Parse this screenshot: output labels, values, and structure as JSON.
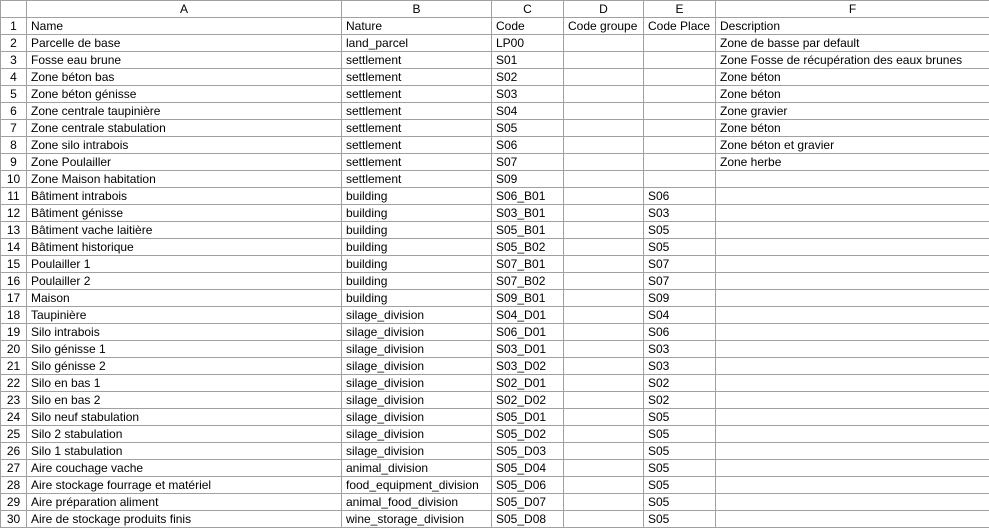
{
  "columns": [
    "A",
    "B",
    "C",
    "D",
    "E",
    "F"
  ],
  "header_row": [
    "Name",
    "Nature",
    "Code",
    "Code groupe",
    "Code Place",
    "Description"
  ],
  "chart_data": {
    "type": "table",
    "title": "",
    "columns": [
      "Name",
      "Nature",
      "Code",
      "Code groupe",
      "Code Place",
      "Description"
    ],
    "rows": [
      [
        "Parcelle de base",
        "land_parcel",
        "LP00",
        "",
        "",
        "Zone de basse par default"
      ],
      [
        "Fosse eau brune",
        "settlement",
        "S01",
        "",
        "",
        "Zone Fosse de récupération des eaux brunes"
      ],
      [
        "Zone béton bas",
        "settlement",
        "S02",
        "",
        "",
        "Zone béton"
      ],
      [
        "Zone béton génisse",
        "settlement",
        "S03",
        "",
        "",
        "Zone béton"
      ],
      [
        "Zone centrale taupinière",
        "settlement",
        "S04",
        "",
        "",
        "Zone gravier"
      ],
      [
        "Zone centrale stabulation",
        "settlement",
        "S05",
        "",
        "",
        "Zone béton"
      ],
      [
        "Zone silo intrabois",
        "settlement",
        "S06",
        "",
        "",
        "Zone béton et gravier"
      ],
      [
        "Zone Poulailler",
        "settlement",
        "S07",
        "",
        "",
        "Zone herbe"
      ],
      [
        "Zone Maison habitation",
        "settlement",
        "S09",
        "",
        "",
        ""
      ],
      [
        "Bâtiment intrabois",
        "building",
        "S06_B01",
        "",
        "S06",
        ""
      ],
      [
        "Bâtiment génisse",
        "building",
        "S03_B01",
        "",
        "S03",
        ""
      ],
      [
        "Bâtiment vache laitière",
        "building",
        "S05_B01",
        "",
        "S05",
        ""
      ],
      [
        "Bâtiment historique",
        "building",
        "S05_B02",
        "",
        "S05",
        ""
      ],
      [
        "Poulailler 1",
        "building",
        "S07_B01",
        "",
        "S07",
        ""
      ],
      [
        "Poulailler 2",
        "building",
        "S07_B02",
        "",
        "S07",
        ""
      ],
      [
        "Maison",
        "building",
        "S09_B01",
        "",
        "S09",
        ""
      ],
      [
        "Taupinière",
        "silage_division",
        "S04_D01",
        "",
        "S04",
        ""
      ],
      [
        "Silo intrabois",
        "silage_division",
        "S06_D01",
        "",
        "S06",
        ""
      ],
      [
        "Silo génisse 1",
        "silage_division",
        "S03_D01",
        "",
        "S03",
        ""
      ],
      [
        "Silo génisse 2",
        "silage_division",
        "S03_D02",
        "",
        "S03",
        ""
      ],
      [
        "Silo en bas 1",
        "silage_division",
        "S02_D01",
        "",
        "S02",
        ""
      ],
      [
        "Silo en bas 2",
        "silage_division",
        "S02_D02",
        "",
        "S02",
        ""
      ],
      [
        "Silo neuf stabulation",
        "silage_division",
        "S05_D01",
        "",
        "S05",
        ""
      ],
      [
        "Silo 2 stabulation",
        "silage_division",
        "S05_D02",
        "",
        "S05",
        ""
      ],
      [
        "Silo 1 stabulation",
        "silage_division",
        "S05_D03",
        "",
        "S05",
        ""
      ],
      [
        "Aire couchage vache",
        "animal_division",
        "S05_D04",
        "",
        "S05",
        ""
      ],
      [
        "Aire stockage fourrage et matériel",
        "food_equipment_division",
        "S05_D06",
        "",
        "S05",
        ""
      ],
      [
        "Aire préparation aliment",
        "animal_food_division",
        "S05_D07",
        "",
        "S05",
        ""
      ],
      [
        "Aire de stockage produits finis",
        "wine_storage_division",
        "S05_D08",
        "",
        "S05",
        ""
      ]
    ]
  }
}
